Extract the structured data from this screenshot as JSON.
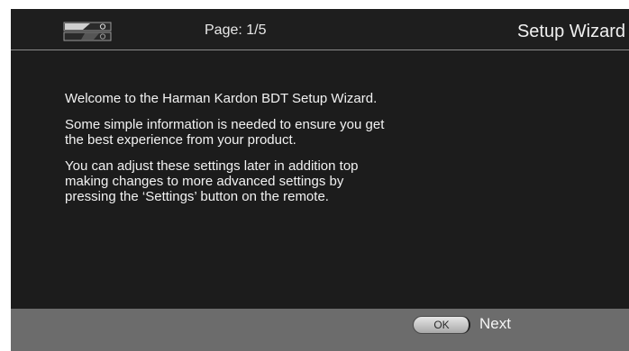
{
  "header": {
    "device_icon": "player-device-icon",
    "page_indicator": "Page: 1/5",
    "title": "Setup Wizard"
  },
  "body": {
    "paragraphs": [
      "Welcome to the Harman Kardon BDT Setup Wizard.",
      "Some simple information is needed to ensure you get the best experience from your product.",
      "You can adjust these settings later in addition top making changes to more advanced settings by pressing the ‘Settings’ button on the remote."
    ]
  },
  "footer": {
    "ok_label": "OK",
    "next_label": "Next"
  },
  "colors": {
    "background": "#1c1c1c",
    "footer": "#6c6c6c",
    "text": "#f2f2f2"
  }
}
